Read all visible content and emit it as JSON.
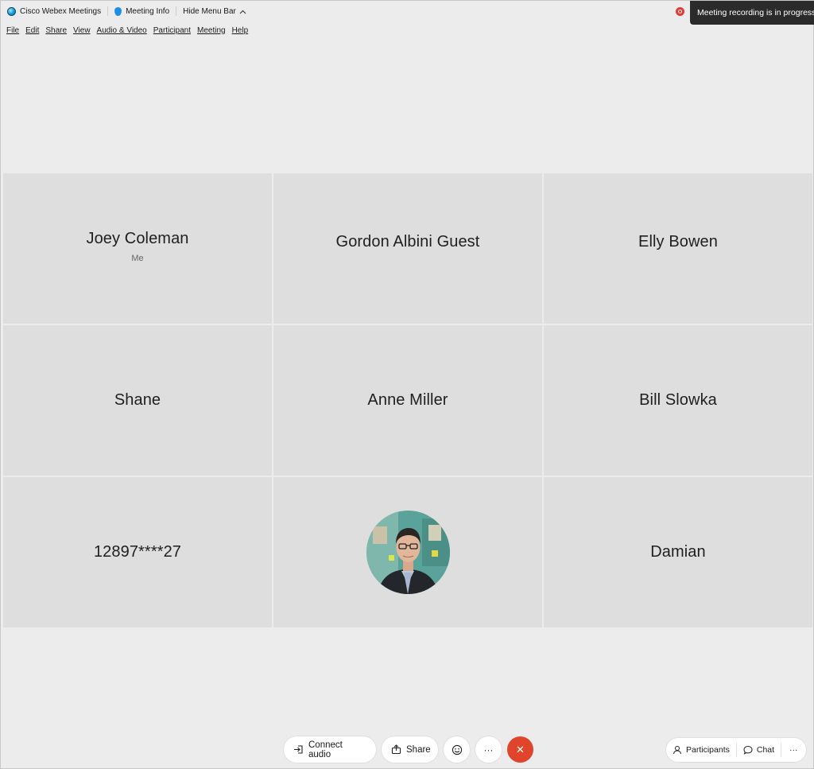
{
  "titlebar": {
    "app_name": "Cisco Webex Meetings",
    "meeting_info": "Meeting Info",
    "hide_menu_bar": "Hide Menu Bar",
    "recording_toast": "Meeting recording is in progress."
  },
  "menu": [
    "File",
    "Edit",
    "Share",
    "View",
    "Audio & Video",
    "Participant",
    "Meeting",
    "Help"
  ],
  "tiles": [
    {
      "name": "Joey Coleman",
      "sub": "Me"
    },
    {
      "name": "Gordon Albini Guest"
    },
    {
      "name": "Elly Bowen"
    },
    {
      "name": "Shane"
    },
    {
      "name": "Anne Miller"
    },
    {
      "name": "Bill Slowka"
    },
    {
      "name": "12897****27"
    },
    {
      "name": ""
    },
    {
      "name": "Damian"
    }
  ],
  "controls": {
    "connect_audio": "Connect audio",
    "share": "Share",
    "more": "···",
    "end": "✕"
  },
  "right_controls": {
    "participants": "Participants",
    "chat": "Chat",
    "more": "···"
  },
  "colors": {
    "end_call": "#e0452b",
    "recording": "#e53935",
    "tile_bg": "#dedede",
    "window_bg": "#ececec"
  }
}
